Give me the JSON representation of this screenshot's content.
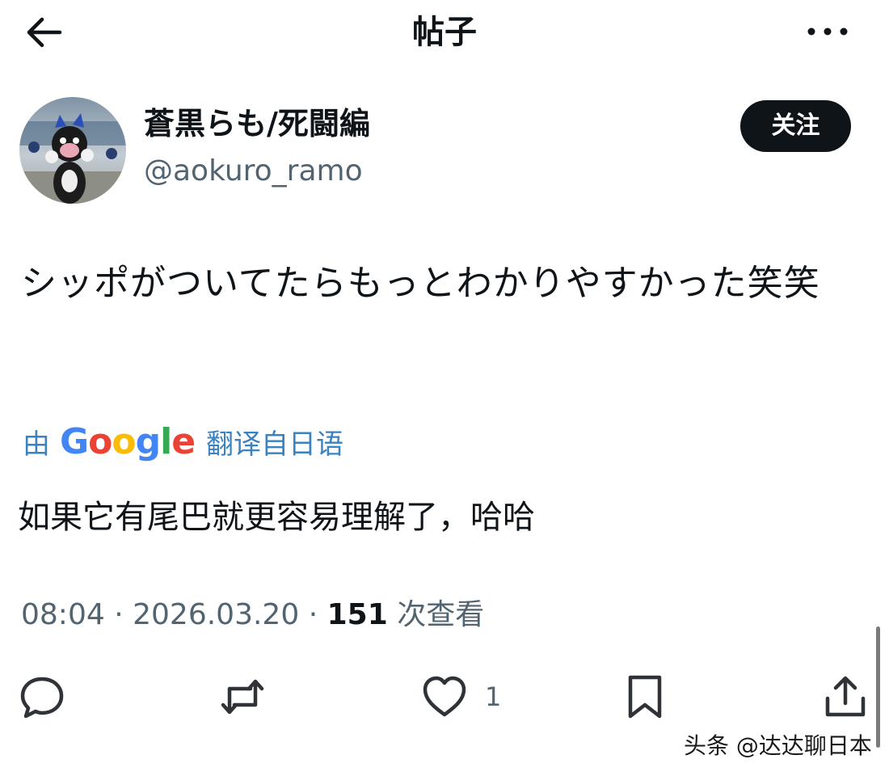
{
  "header": {
    "title": "帖子",
    "back_icon": "arrow-left-icon",
    "more_icon": "more-horizontal-icon"
  },
  "author": {
    "display_name": "蒼黒らも/死闘編",
    "handle": "@aokuro_ramo",
    "follow_label": "关注"
  },
  "post": {
    "text": "シッポがついてたらもっとわかりやすかった笑笑",
    "translation_prefix": "由",
    "translation_brand": "Google",
    "translation_suffix": "翻译自日语",
    "translated_text": "如果它有尾巴就更容易理解了，哈哈",
    "time": "08:04",
    "date": "2026.03.20",
    "separator": "·",
    "views": "151",
    "views_label": "次查看"
  },
  "actions": {
    "reply_icon": "reply-icon",
    "repost_icon": "repost-icon",
    "like_icon": "heart-icon",
    "like_count": "1",
    "bookmark_icon": "bookmark-icon",
    "share_icon": "share-icon"
  },
  "watermark": "头条 @达达聊日本",
  "colors": {
    "text": "#0f1419",
    "secondary": "#536471",
    "link": "#3a82c0",
    "follow_bg": "#0f1419"
  }
}
